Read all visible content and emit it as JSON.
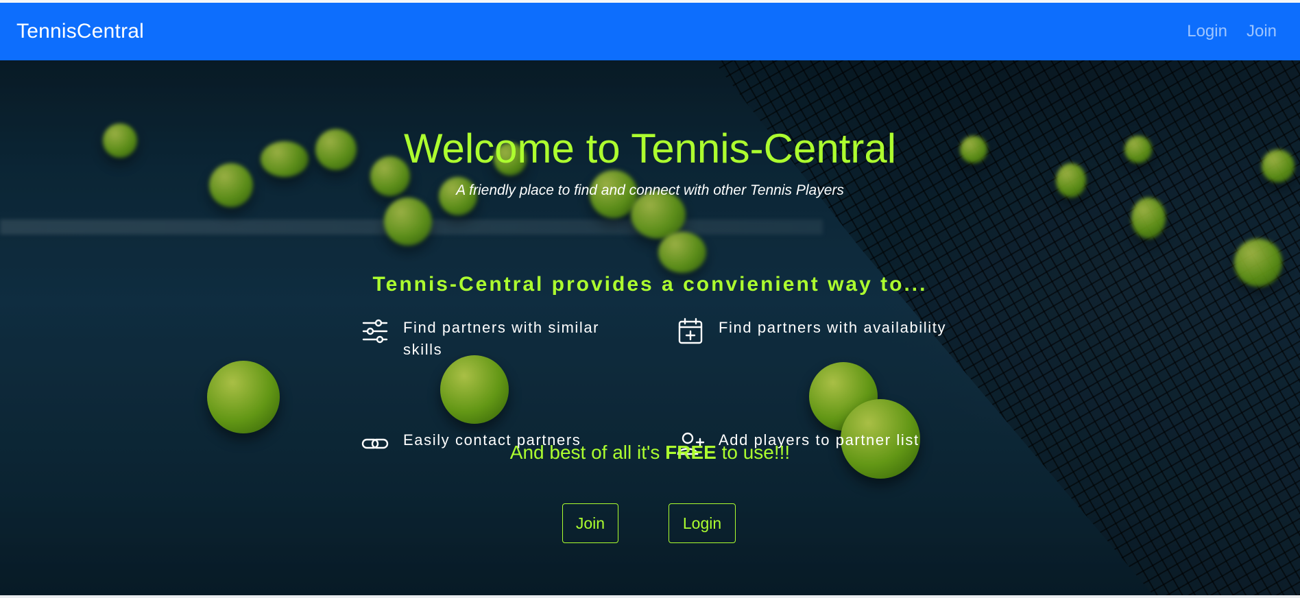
{
  "navbar": {
    "brand": "TennisCentral",
    "links": [
      {
        "label": "Login"
      },
      {
        "label": "Join"
      }
    ]
  },
  "hero": {
    "title": "Welcome to Tennis-Central",
    "subtitle": "A friendly place to find and connect with other Tennis Players",
    "features_heading": "Tennis-Central provides a convienient way to...",
    "features": [
      {
        "icon": "sliders-icon",
        "label": "Find partners with similar skills"
      },
      {
        "icon": "calendar-plus-icon",
        "label": "Find partners with availability"
      },
      {
        "icon": "link-icon",
        "label": "Easily contact partners"
      },
      {
        "icon": "person-add-icon",
        "label": "Add players to partner list"
      }
    ],
    "free_prefix": "And best of all it's",
    "free_emphasis": "FREE",
    "free_suffix": "to use!!!",
    "buttons": {
      "join": "Join",
      "login": "Login"
    }
  },
  "colors": {
    "navbar": "#0d6efd",
    "accent": "#adff2f",
    "text": "#ffffff"
  }
}
